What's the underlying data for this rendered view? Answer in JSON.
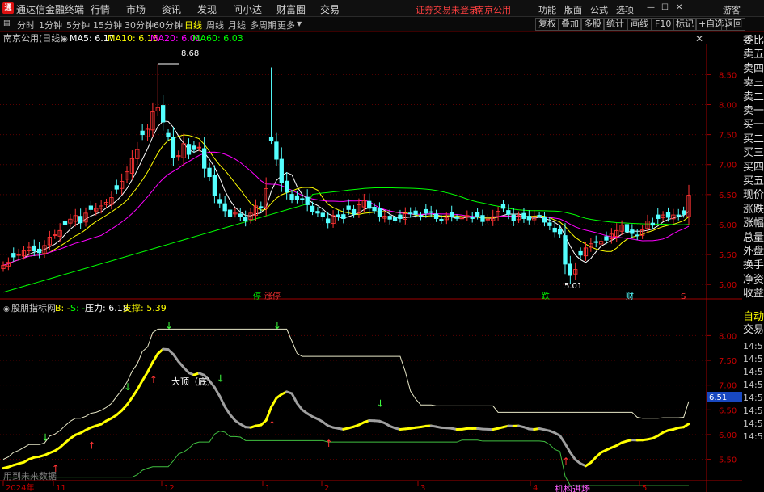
{
  "titlebar": {
    "app_name": "通达信金融终端",
    "menu": [
      "行情",
      "市场",
      "资讯",
      "发现",
      "问小达",
      "财富圈",
      "交易"
    ],
    "notice": "证券交易未登录",
    "stock": "南京公用",
    "right_menu": [
      "功能",
      "版面",
      "公式",
      "选项"
    ],
    "guest": "游客"
  },
  "periods": [
    "分时",
    "1分钟",
    "5分钟",
    "15分钟",
    "30分钟",
    "60分钟",
    "日线",
    "周线",
    "月线",
    "多周期",
    "更多"
  ],
  "active_period": "日线",
  "right_buttons": [
    "复权",
    "叠加",
    "多股",
    "统计",
    "画线",
    "F10",
    "标记",
    "+自选",
    "返回"
  ],
  "side_labels": [
    "委比",
    "卖五",
    "卖四",
    "卖三",
    "卖二",
    "卖一",
    "买一",
    "买二",
    "买三",
    "买四",
    "买五",
    "现价",
    "涨跌",
    "涨幅",
    "总量",
    "外盘",
    "换手",
    "净资",
    "收益"
  ],
  "side_buttons": [
    "自动",
    "交易"
  ],
  "colors": {
    "up": "#ff3333",
    "down": "#54ffff",
    "ma5": "#ffffff",
    "ma10": "#ffff00",
    "ma20": "#ff00ff",
    "ma60": "#00ff00",
    "yellow": "#ffff00",
    "gray": "#a0a0a0"
  },
  "chart_data": [
    {
      "type": "candlestick",
      "header": "南京公用(日线)",
      "legend": [
        {
          "label": "MA5: 6.17",
          "color": "#ffffff"
        },
        {
          "label": "MA10: 6.15",
          "color": "#ffff00"
        },
        {
          "label": "MA20: 6.01",
          "color": "#ff00ff"
        },
        {
          "label": "MA60: 6.03",
          "color": "#00ff00"
        }
      ],
      "y_ticks": [
        "8.50",
        "8.00",
        "7.50",
        "7.00",
        "6.50",
        "6.00",
        "5.50",
        "5.00"
      ],
      "ylim": [
        4.8,
        8.95
      ],
      "x_ticks": [
        "2024年",
        "11",
        "12",
        "1",
        "2",
        "3",
        "4",
        "5"
      ],
      "annotations": {
        "high": "8.68",
        "low": "5.01"
      },
      "markers": [
        "停",
        "涨停",
        "跌",
        "财",
        "S"
      ],
      "series": {
        "closes": [
          5.32,
          5.37,
          5.46,
          5.5,
          5.56,
          5.62,
          5.56,
          5.53,
          5.65,
          5.79,
          5.83,
          5.9,
          6,
          6.09,
          6.15,
          6.03,
          6.19,
          6.25,
          6.27,
          6.31,
          6.37,
          6.45,
          6.59,
          6.72,
          6.88,
          7.1,
          7.25,
          7.5,
          7.59,
          7.88,
          7.95,
          7.71,
          7.46,
          7.11,
          7.15,
          7.35,
          7.17,
          7.25,
          7.29,
          6.94,
          6.8,
          6.49,
          6.36,
          6.23,
          6.14,
          6.2,
          6.13,
          6.06,
          6.19,
          6.31,
          6.28,
          6.6,
          7.4,
          7.09,
          6.7,
          6.54,
          6.42,
          6.42,
          6.42,
          6.33,
          6.22,
          6.19,
          6.13,
          6.03,
          6.15,
          6.13,
          6.1,
          6.25,
          6.17,
          6.33,
          6.4,
          6.27,
          6.23,
          6.13,
          6.14,
          6.09,
          6.07,
          6.1,
          6.18,
          6.19,
          6.17,
          6.13,
          6.19,
          6.21,
          6.1,
          6.07,
          6.11,
          6.14,
          6.11,
          6.11,
          6.15,
          6.11,
          6.14,
          6.05,
          6.09,
          6.13,
          6.22,
          6.27,
          6.17,
          6.07,
          6.15,
          6.1,
          6.08,
          6.13,
          6.15,
          6.04,
          5.98,
          5.88,
          5.84,
          5.34,
          5.15,
          5.25,
          5.49,
          5.61,
          5.68,
          5.7,
          5.72,
          5.74,
          5.84,
          5.9,
          5.99,
          5.88,
          5.85,
          5.82,
          5.91,
          6.06,
          5.99,
          6.1,
          6.16,
          6.12,
          6.16,
          6.15,
          6.17,
          6.49
        ]
      }
    },
    {
      "type": "indicator",
      "header": "股朋指标网",
      "legend": [
        {
          "label": "B: -",
          "color": "#ffff00"
        },
        {
          "label": "S: -",
          "color": "#00ff00"
        },
        {
          "label": "压力: 6.18",
          "color": "#ffffff"
        },
        {
          "label": "支撑: 5.39",
          "color": "#ffff00"
        }
      ],
      "y_ticks": [
        "8.00",
        "7.50",
        "7.00",
        "6.50",
        "6.00",
        "5.50"
      ],
      "current_value": "6.51",
      "labels": [
        "大顶（底）",
        "机构进场"
      ],
      "bottom_text": "用到未来数据"
    }
  ]
}
